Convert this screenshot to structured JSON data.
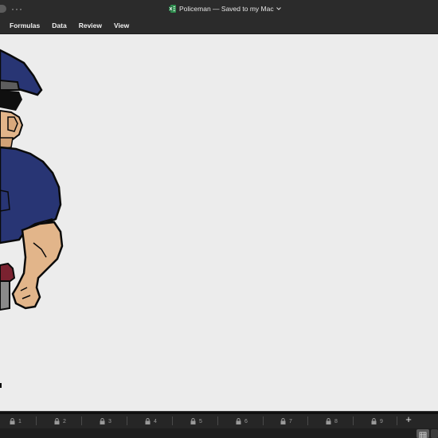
{
  "window": {
    "document_title": "Policeman — Saved to my Mac",
    "more_glyph": "···"
  },
  "menu": {
    "items": [
      "Formulas",
      "Data",
      "Review",
      "View"
    ]
  },
  "sheets": {
    "tabs": [
      "1",
      "2",
      "3",
      "4",
      "5",
      "6",
      "7",
      "8",
      "9"
    ],
    "add_label": "+"
  },
  "icons": {
    "doc": "excel-doc-icon",
    "lock": "lock-icon",
    "grid": "grid-view-icon",
    "chevron": "chevron-down-icon"
  },
  "colors": {
    "uniform": "#283574",
    "skin": "#e2b58a",
    "hair": "#0f0f0f",
    "holster": "#7a2230",
    "grey": "#8a8a8a",
    "canvas_bg": "#ececec",
    "chrome_bg": "#2b2b2b"
  }
}
